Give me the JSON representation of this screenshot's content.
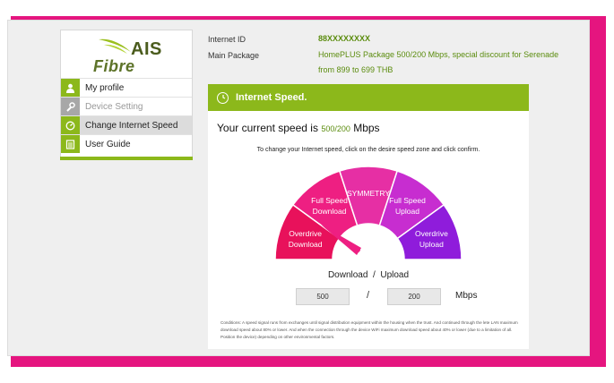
{
  "logo": {
    "brand": "AIS",
    "product": "Fibre"
  },
  "sidebar": {
    "items": [
      {
        "label": "My profile",
        "icon": "user-icon",
        "state": "normal"
      },
      {
        "label": "Device Setting",
        "icon": "wrench-icon",
        "state": "disabled"
      },
      {
        "label": "Change Internet Speed",
        "icon": "speedometer-icon",
        "state": "active"
      },
      {
        "label": "User Guide",
        "icon": "book-icon",
        "state": "normal"
      }
    ]
  },
  "info": {
    "id_label": "Internet ID",
    "id_value": "88XXXXXXXX",
    "package_label": "Main Package",
    "package_value": "HomePLUS Package 500/200 Mbps, special discount for Serenade from 899 to 699 THB"
  },
  "panel": {
    "title": "Internet Speed.",
    "current_speed_prefix": "Your current speed is",
    "current_speed_value": "500/200",
    "current_speed_unit": "Mbps",
    "instruction": "To change your Internet speed, click on the desire speed zone and click confirm.",
    "gauge": {
      "zones": [
        {
          "line1": "Overdrive",
          "line2": "Download",
          "color": "#e8115b"
        },
        {
          "line1": "Full Speed",
          "line2": "Download",
          "color": "#ee1f82"
        },
        {
          "line1": "SYMMETRY",
          "line2": "",
          "color": "#e62fa4"
        },
        {
          "line1": "Full Speed",
          "line2": "Upload",
          "color": "#c72dd0"
        },
        {
          "line1": "Overdrive",
          "line2": "Upload",
          "color": "#8f1cdb"
        }
      ],
      "selected_zone": "Full Speed Download"
    },
    "download_label": "Download",
    "separator": "/",
    "upload_label": "Upload",
    "download_value": "500",
    "upload_value": "200",
    "unit": "Mbps",
    "conditions": "Conditions: A speed signal runs from exchanges until signal distribution equipment within the housing when the trust. And continued through the lete LAN maximum download speed about 80% or lower. And when the connection through the device WiFi maximum download speed about 40% or lower (due to a limitation of all. Position the device) depending on other environmental factors."
  }
}
